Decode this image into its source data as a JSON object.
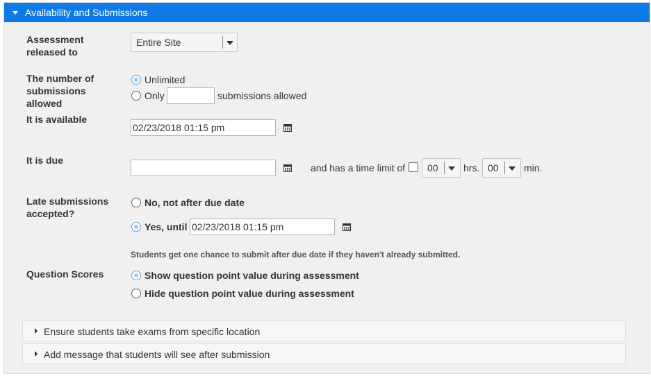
{
  "panel": {
    "title": "Availability and Submissions"
  },
  "released": {
    "label_line1": "Assessment",
    "label_line2": "released to",
    "selected": "Entire Site"
  },
  "submissions": {
    "label_line1": "The number of",
    "label_line2": "submissions",
    "label_line3": "allowed",
    "option_unlimited": "Unlimited",
    "option_only": "Only",
    "only_value": "",
    "only_suffix": "submissions allowed"
  },
  "available": {
    "label": "It is available",
    "value": "02/23/2018 01:15 pm"
  },
  "due": {
    "label": "It is due",
    "value": "",
    "time_limit_text": "and has a time limit of",
    "hours_value": "00",
    "hours_label": "hrs.",
    "minutes_value": "00",
    "minutes_label": "min."
  },
  "late": {
    "label_line1": "Late submissions",
    "label_line2": "accepted?",
    "option_no": "No, not after due date",
    "option_yes": "Yes, until",
    "yes_value": "02/23/2018 01:15 pm",
    "note": "Students get one chance to submit after due date if they haven't already submitted."
  },
  "scores": {
    "label": "Question Scores",
    "option_show": "Show question point value during assessment",
    "option_hide": "Hide question point value during assessment"
  },
  "sections": {
    "location": "Ensure students take exams from specific location",
    "message": "Add message that students will see after submission"
  },
  "icons": {
    "calendar": "calendar-icon",
    "caret": "caret-down-icon"
  },
  "colors": {
    "header": "#0f7ae5",
    "panel_bg": "#f0f0f0"
  }
}
